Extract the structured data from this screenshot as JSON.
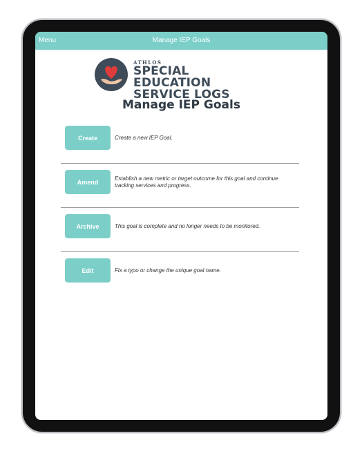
{
  "topbar": {
    "menu_label": "Menu",
    "title": "Manage IEP Goals"
  },
  "logo": {
    "line1": "ATHLOS",
    "line2": "SPECIAL EDUCATION",
    "line3": "SERVICE LOGS"
  },
  "page": {
    "title": "Manage IEP Goals"
  },
  "actions": [
    {
      "label": "Create",
      "description": "Create a new IEP Goal."
    },
    {
      "label": "Amend",
      "description": "Establish a new metric or target outcome for this goal and continue tracking services and progress."
    },
    {
      "label": "Archive",
      "description": "This goal is complete and no longer needs to be monitored."
    },
    {
      "label": "Edit",
      "description": "Fix a typo or change the unique goal name."
    }
  ],
  "colors": {
    "accent": "#7ccfc9",
    "logo_dark": "#3e4c59",
    "heart": "#e03b3b",
    "hand": "#f3c9a8"
  }
}
